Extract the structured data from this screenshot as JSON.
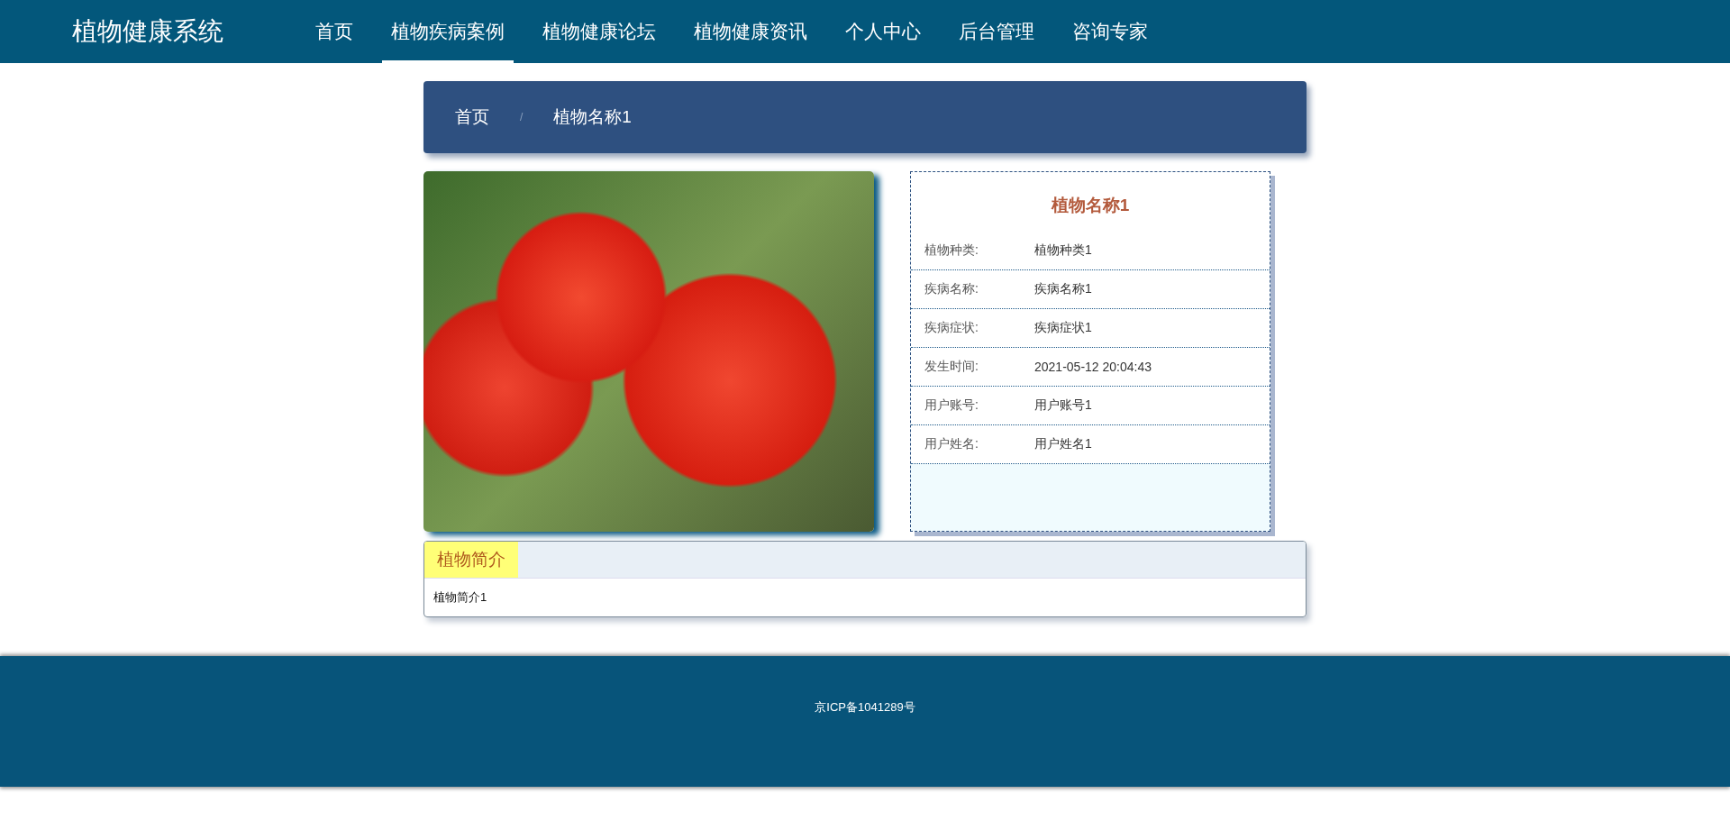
{
  "site_title": "植物健康系统",
  "nav": [
    {
      "label": "首页",
      "selected": false
    },
    {
      "label": "植物疾病案例",
      "selected": true
    },
    {
      "label": "植物健康论坛",
      "selected": false
    },
    {
      "label": "植物健康资讯",
      "selected": false
    },
    {
      "label": "个人中心",
      "selected": false
    },
    {
      "label": "后台管理",
      "selected": false
    },
    {
      "label": "咨询专家",
      "selected": false
    }
  ],
  "breadcrumb": {
    "items": [
      "首页",
      "植物名称1"
    ],
    "separator": "/"
  },
  "detail": {
    "title": "植物名称1",
    "fields": [
      {
        "label": "植物种类:",
        "value": "植物种类1"
      },
      {
        "label": "疾病名称:",
        "value": "疾病名称1"
      },
      {
        "label": "疾病症状:",
        "value": "疾病症状1"
      },
      {
        "label": "发生时间:",
        "value": "2021-05-12 20:04:43"
      },
      {
        "label": "用户账号:",
        "value": "用户账号1"
      },
      {
        "label": "用户姓名:",
        "value": "用户姓名1"
      }
    ]
  },
  "intro": {
    "tab": "植物简介",
    "text": "植物简介1"
  },
  "footer": {
    "text": "京ICP备1041289号"
  }
}
